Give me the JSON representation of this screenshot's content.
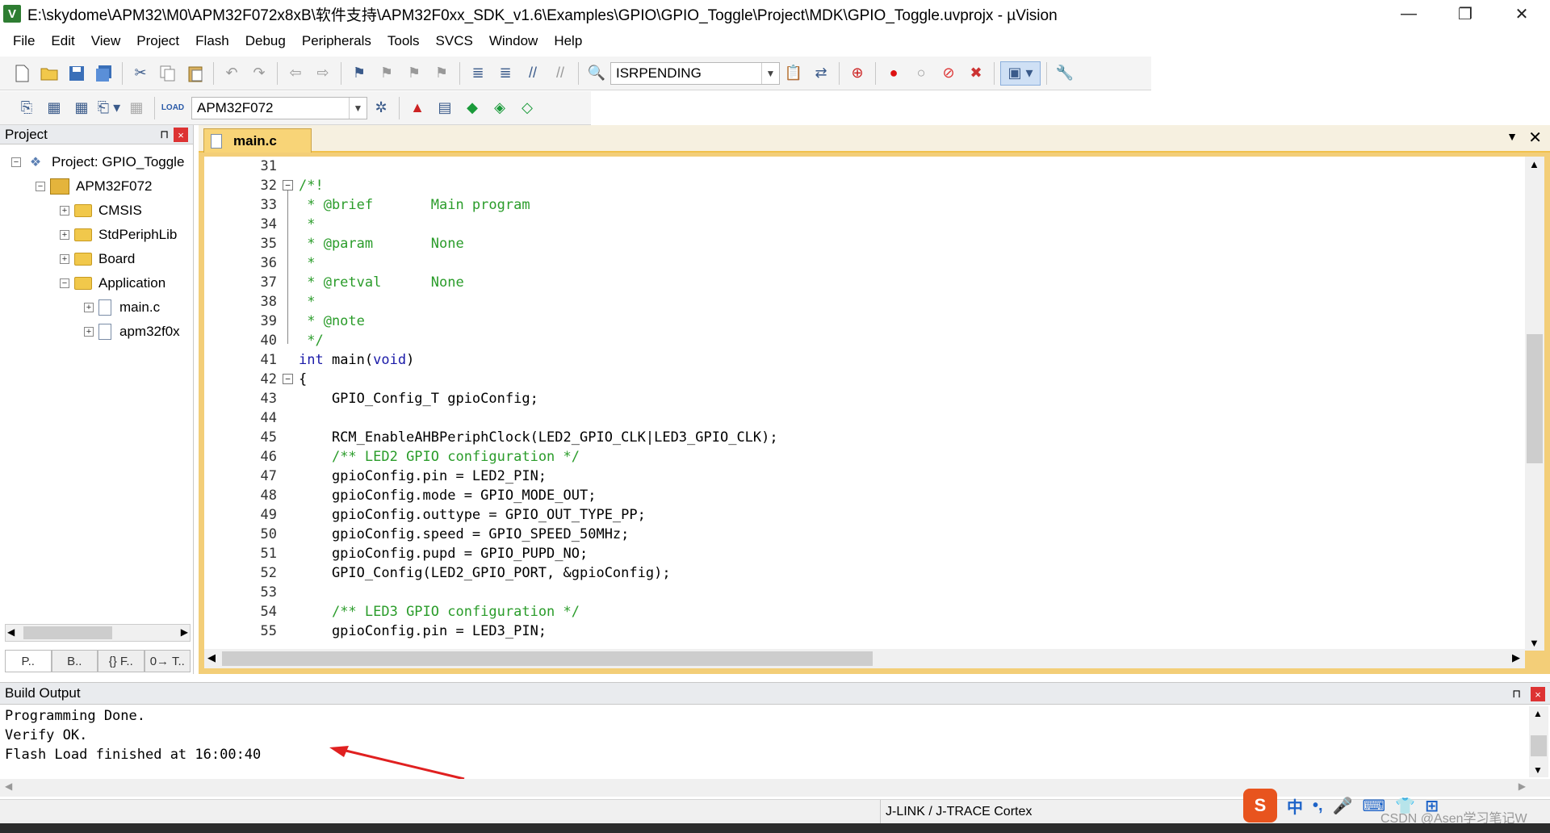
{
  "window": {
    "title": "E:\\skydome\\APM32\\M0\\APM32F072x8xB\\软件支持\\APM32F0xx_SDK_v1.6\\Examples\\GPIO\\GPIO_Toggle\\Project\\MDK\\GPIO_Toggle.uvprojx - µVision",
    "minimize": "—",
    "restore": "❐",
    "close": "✕"
  },
  "menubar": [
    "File",
    "Edit",
    "View",
    "Project",
    "Flash",
    "Debug",
    "Peripherals",
    "Tools",
    "SVCS",
    "Window",
    "Help"
  ],
  "toolbar1": {
    "find_combo": "ISRPENDING"
  },
  "toolbar2": {
    "target_combo": "APM32F072"
  },
  "project_panel": {
    "title": "Project",
    "pin": "⊓",
    "close": "×",
    "tree": {
      "project": "Project: GPIO_Toggle",
      "target": "APM32F072",
      "groups": [
        "CMSIS",
        "StdPeriphLib",
        "Board",
        "Application"
      ],
      "files": [
        "main.c",
        "apm32f0x"
      ]
    },
    "tabs": [
      "P..",
      "B..",
      "{} F..",
      "0→ T.."
    ]
  },
  "editor": {
    "tab_label": "main.c",
    "lines": [
      {
        "n": "31",
        "fold": "",
        "segments": [
          {
            "t": "",
            "c": ""
          }
        ]
      },
      {
        "n": "32",
        "fold": "−",
        "segments": [
          {
            "t": "/*!",
            "c": "cmt"
          }
        ]
      },
      {
        "n": "33",
        "fold": "",
        "segments": [
          {
            "t": " * @brief       Main program",
            "c": "cmt"
          }
        ]
      },
      {
        "n": "34",
        "fold": "",
        "segments": [
          {
            "t": " *",
            "c": "cmt"
          }
        ]
      },
      {
        "n": "35",
        "fold": "",
        "segments": [
          {
            "t": " * @param       None",
            "c": "cmt"
          }
        ]
      },
      {
        "n": "36",
        "fold": "",
        "segments": [
          {
            "t": " *",
            "c": "cmt"
          }
        ]
      },
      {
        "n": "37",
        "fold": "",
        "segments": [
          {
            "t": " * @retval      None",
            "c": "cmt"
          }
        ]
      },
      {
        "n": "38",
        "fold": "",
        "segments": [
          {
            "t": " *",
            "c": "cmt"
          }
        ]
      },
      {
        "n": "39",
        "fold": "",
        "segments": [
          {
            "t": " * @note",
            "c": "cmt"
          }
        ]
      },
      {
        "n": "40",
        "fold": "",
        "segments": [
          {
            "t": " */",
            "c": "cmt"
          }
        ]
      },
      {
        "n": "41",
        "fold": "",
        "segments": [
          {
            "t": "int",
            "c": "kw"
          },
          {
            "t": " main(",
            "c": ""
          },
          {
            "t": "void",
            "c": "kw"
          },
          {
            "t": ")",
            "c": ""
          }
        ]
      },
      {
        "n": "42",
        "fold": "−",
        "segments": [
          {
            "t": "{",
            "c": ""
          }
        ]
      },
      {
        "n": "43",
        "fold": "",
        "segments": [
          {
            "t": "    GPIO_Config_T gpioConfig;",
            "c": ""
          }
        ]
      },
      {
        "n": "44",
        "fold": "",
        "segments": [
          {
            "t": "",
            "c": ""
          }
        ]
      },
      {
        "n": "45",
        "fold": "",
        "segments": [
          {
            "t": "    RCM_EnableAHBPeriphClock(LED2_GPIO_CLK|LED3_GPIO_CLK);",
            "c": ""
          }
        ]
      },
      {
        "n": "46",
        "fold": "",
        "segments": [
          {
            "t": "    ",
            "c": ""
          },
          {
            "t": "/** LED2 GPIO configuration */",
            "c": "cmt"
          }
        ]
      },
      {
        "n": "47",
        "fold": "",
        "segments": [
          {
            "t": "    gpioConfig.pin = LED2_PIN;",
            "c": ""
          }
        ]
      },
      {
        "n": "48",
        "fold": "",
        "segments": [
          {
            "t": "    gpioConfig.mode = GPIO_MODE_OUT;",
            "c": ""
          }
        ]
      },
      {
        "n": "49",
        "fold": "",
        "segments": [
          {
            "t": "    gpioConfig.outtype = GPIO_OUT_TYPE_PP;",
            "c": ""
          }
        ]
      },
      {
        "n": "50",
        "fold": "",
        "segments": [
          {
            "t": "    gpioConfig.speed = GPIO_SPEED_50MHz;",
            "c": ""
          }
        ]
      },
      {
        "n": "51",
        "fold": "",
        "segments": [
          {
            "t": "    gpioConfig.pupd = GPIO_PUPD_NO;",
            "c": ""
          }
        ]
      },
      {
        "n": "52",
        "fold": "",
        "segments": [
          {
            "t": "    GPIO_Config(LED2_GPIO_PORT, &gpioConfig);",
            "c": ""
          }
        ]
      },
      {
        "n": "53",
        "fold": "",
        "segments": [
          {
            "t": "",
            "c": ""
          }
        ]
      },
      {
        "n": "54",
        "fold": "",
        "segments": [
          {
            "t": "    ",
            "c": ""
          },
          {
            "t": "/** LED3 GPIO configuration */",
            "c": "cmt"
          }
        ]
      },
      {
        "n": "55",
        "fold": "",
        "segments": [
          {
            "t": "    gpioConfig.pin = LED3_PIN;",
            "c": ""
          }
        ]
      }
    ]
  },
  "build_output": {
    "title": "Build Output",
    "lines": [
      "Programming Done.",
      "Verify OK.",
      "Flash Load finished at 16:00:40"
    ]
  },
  "statusbar": {
    "debugger": "J-LINK / J-TRACE Cortex"
  },
  "ime": {
    "logo": "S",
    "items": [
      "中",
      "•,",
      "🎤",
      "⌨",
      "👕",
      "⊞"
    ]
  },
  "watermark": "CSDN @Asen学习笔记W",
  "colors": {
    "comment": "#2a9c2a",
    "keyword": "#1a1aa8",
    "tab_active": "#f8d477",
    "close_red": "#dd3333"
  }
}
